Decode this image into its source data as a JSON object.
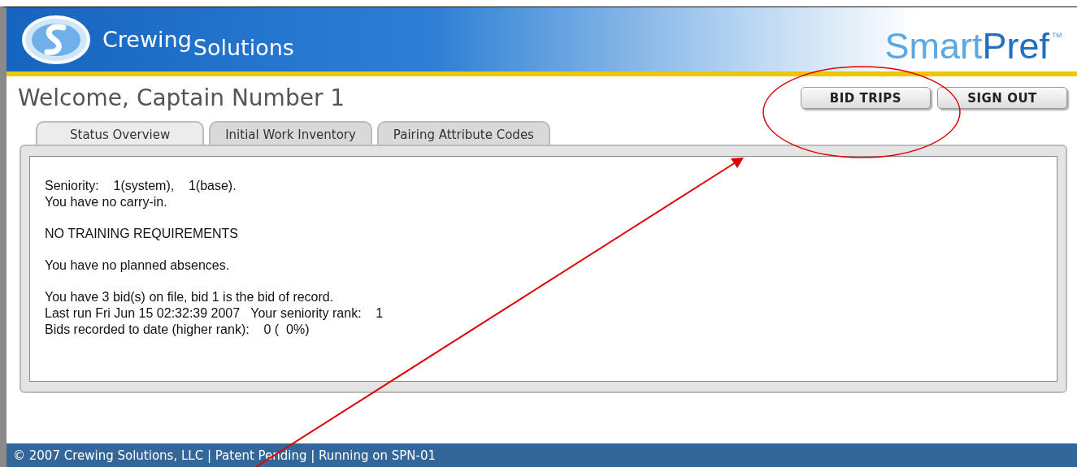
{
  "header": {
    "company": {
      "first": "Crewing",
      "second": "Solutions"
    },
    "product": {
      "first": "Smart",
      "second": "Pref",
      "mark": "™"
    }
  },
  "welcome": "Welcome, Captain Number 1",
  "buttons": [
    "BID TRIPS",
    "SIGN OUT"
  ],
  "tabs": [
    {
      "label": "Status Overview",
      "selected": true
    },
    {
      "label": "Initial Work Inventory",
      "selected": false
    },
    {
      "label": "Pairing Attribute Codes",
      "selected": false
    }
  ],
  "status_paragraphs": [
    [
      "Seniority:    1(system),    1(base).",
      "You have no carry-in."
    ],
    [
      "NO TRAINING REQUIREMENTS"
    ],
    [
      "You have no planned absences."
    ],
    [
      "You have 3 bid(s) on file, bid 1 is the bid of record.",
      "Last run Fri Jun 15 02:32:39 2007   Your seniority rank:    1",
      "Bids recorded to date (higher rank):    0 (  0%)"
    ]
  ],
  "footer": "© 2007 Crewing Solutions, LLC | Patent Pending | Running on SPN-01"
}
